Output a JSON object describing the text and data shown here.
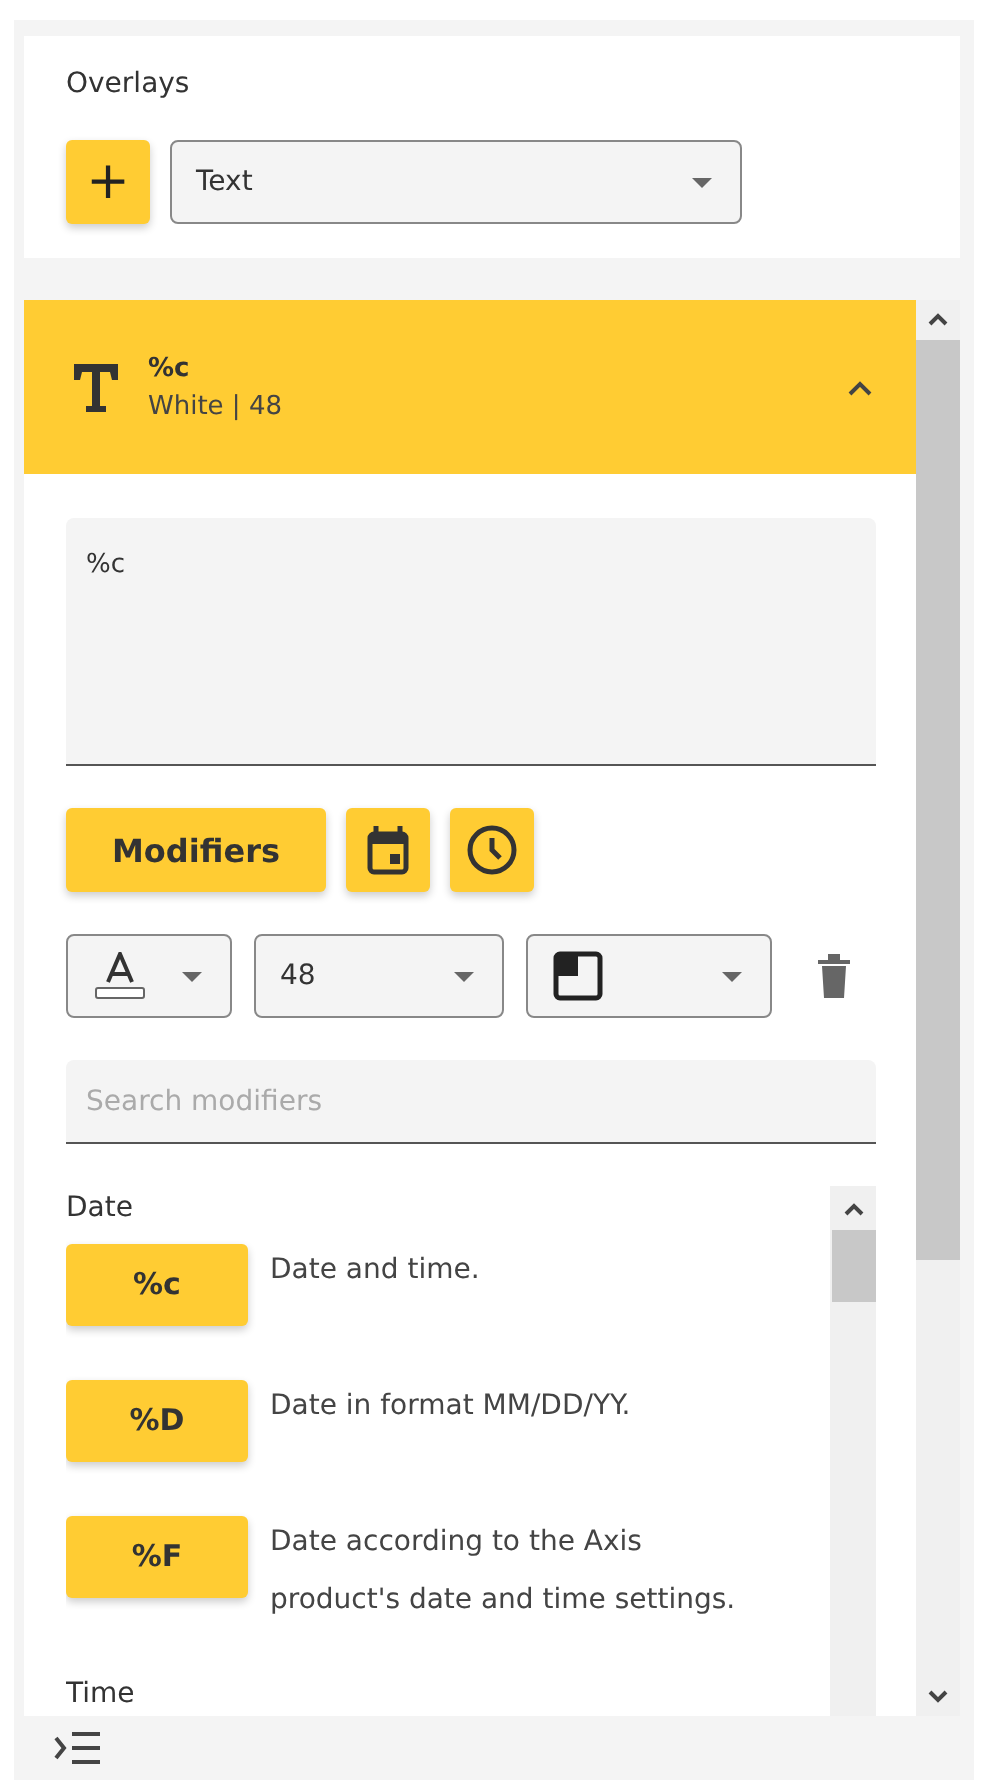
{
  "panel": {
    "title": "Overlays",
    "add_button": "+",
    "type_select": "Text"
  },
  "overlay": {
    "title": "%c",
    "subtitle": "White | 48",
    "expanded": true,
    "text_value": "%c",
    "modifiers_button": "Modifiers",
    "size_select": "48",
    "search": {
      "placeholder": "Search modifiers"
    },
    "groups": [
      {
        "title": "Date",
        "items": [
          {
            "code": "%c",
            "description": "Date and time."
          },
          {
            "code": "%D",
            "description": "Date in format MM/DD/YY."
          },
          {
            "code": "%F",
            "description": "Date according to the Axis product's date and time settings."
          }
        ]
      },
      {
        "title": "Time"
      }
    ]
  }
}
